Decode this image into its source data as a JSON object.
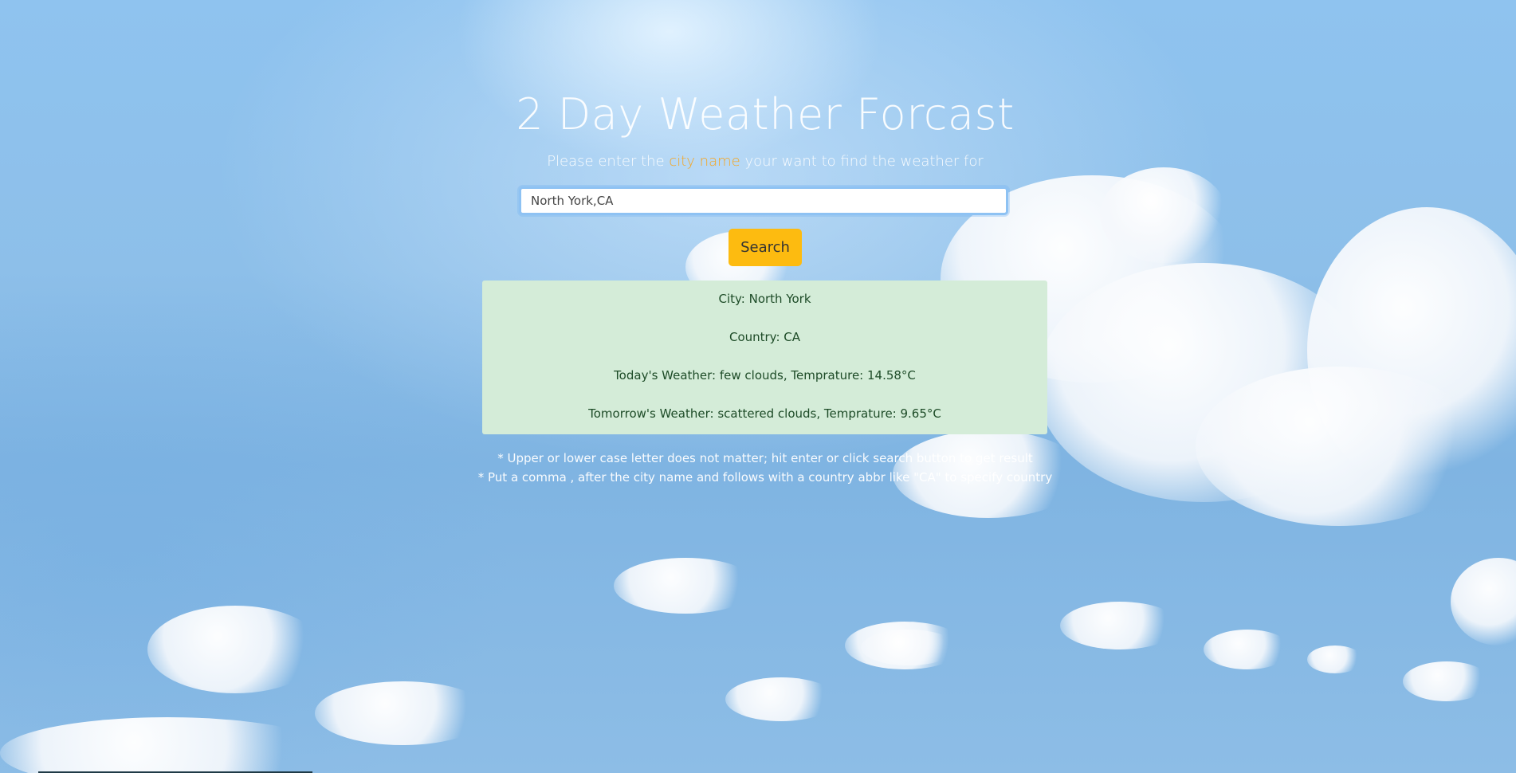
{
  "header": {
    "title": "2 Day Weather Forcast",
    "subtitle_before": "Please enter the ",
    "subtitle_highlight": "city name",
    "subtitle_after": " your want to find the weather for"
  },
  "search": {
    "value": "North York,CA",
    "button_label": "Search"
  },
  "result": {
    "city": "City: North York",
    "country": "Country: CA",
    "today": "Today's Weather: few clouds, Temprature: 14.58°C",
    "tomorrow": "Tomorrow's Weather: scattered clouds, Temprature: 9.65°C"
  },
  "notes": {
    "note1": "* Upper or lower case letter does not matter; hit enter or click search button to get result",
    "note2": "* Put a comma , after the city name and follows with a country abbr like \"CA\" to specify country"
  },
  "colors": {
    "highlight": "#f5a623",
    "button": "#fdbb10",
    "result_bg": "#d4ecd8",
    "result_text": "#1d4b27"
  }
}
